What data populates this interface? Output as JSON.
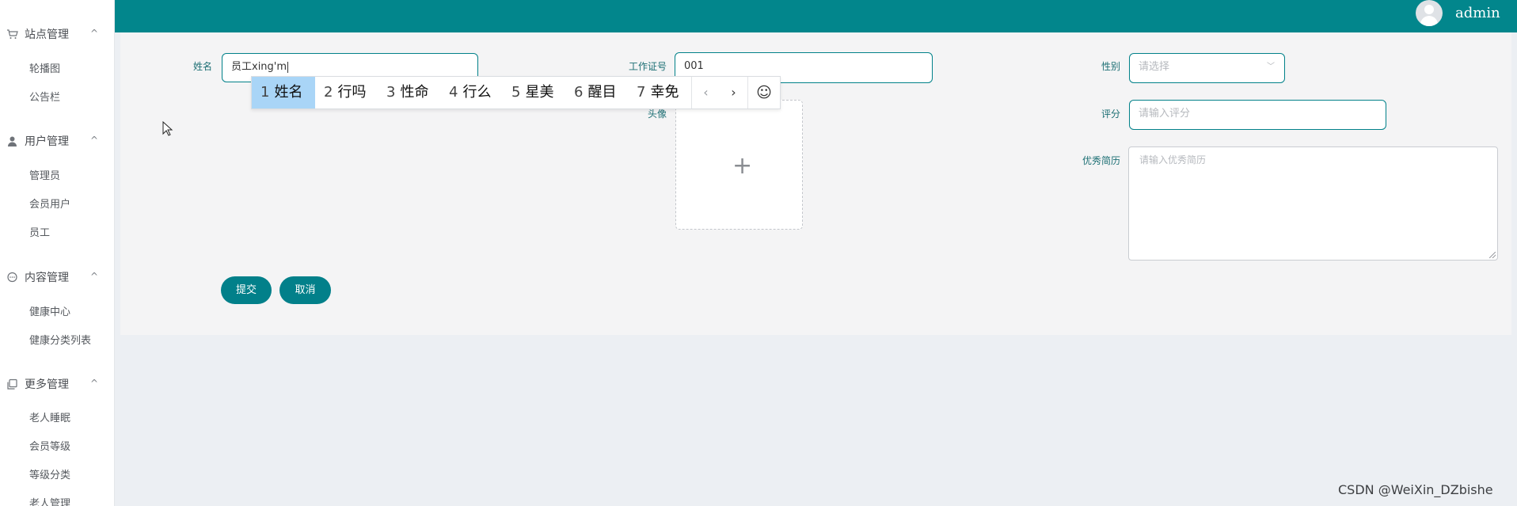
{
  "header": {
    "username": "admin"
  },
  "sidebar": {
    "groups": [
      {
        "label": "站点管理",
        "icon": "shop-icon",
        "items": [
          "轮播图",
          "公告栏"
        ]
      },
      {
        "label": "用户管理",
        "icon": "user-icon",
        "items": [
          "管理员",
          "会员用户",
          "员工"
        ]
      },
      {
        "label": "内容管理",
        "icon": "chat-icon",
        "items": [
          "健康中心",
          "健康分类列表"
        ]
      },
      {
        "label": "更多管理",
        "icon": "copy-icon",
        "items": [
          "老人睡眠",
          "会员等级",
          "等级分类",
          "老人管理"
        ]
      }
    ]
  },
  "form": {
    "name": {
      "label": "姓名",
      "value": "员工xing'm"
    },
    "work_id": {
      "label": "工作证号",
      "value": "001"
    },
    "gender": {
      "label": "性别",
      "placeholder": "请选择"
    },
    "avatar": {
      "label": "头像"
    },
    "score": {
      "label": "评分",
      "placeholder": "请输入评分"
    },
    "resume": {
      "label": "优秀简历",
      "placeholder": "请输入优秀简历"
    },
    "submit_label": "提交",
    "cancel_label": "取消"
  },
  "ime": {
    "candidates": [
      {
        "num": "1",
        "text": "姓名"
      },
      {
        "num": "2",
        "text": "行吗"
      },
      {
        "num": "3",
        "text": "性命"
      },
      {
        "num": "4",
        "text": "行么"
      },
      {
        "num": "5",
        "text": "星美"
      },
      {
        "num": "6",
        "text": "醒目"
      },
      {
        "num": "7",
        "text": "幸免"
      }
    ],
    "selected_index": 0
  },
  "watermark": "CSDN @WeiXin_DZbishe"
}
